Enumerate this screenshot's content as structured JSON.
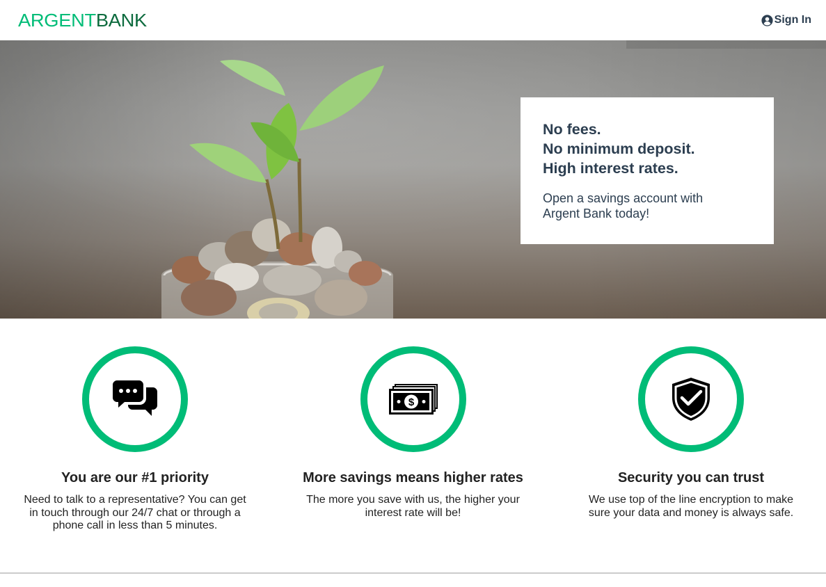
{
  "nav": {
    "logo_part1": "ARGENT",
    "logo_part2": "BANK",
    "signin_label": "Sign In",
    "signin_icon": "user-circle-icon"
  },
  "hero": {
    "image_subject": "plant growing from jar of coins",
    "promo_lines": [
      "No fees.",
      "No minimum deposit.",
      "High interest rates."
    ],
    "promo_text": "Open a savings account with Argent Bank today!"
  },
  "features": [
    {
      "icon": "chat-icon",
      "title": "You are our #1 priority",
      "text": "Need to talk to a representative? You can get in touch through our 24/7 chat or through a phone call in less than 5 minutes."
    },
    {
      "icon": "money-icon",
      "title": "More savings means higher rates",
      "text": "The more you save with us, the higher your interest rate will be!"
    },
    {
      "icon": "security-icon",
      "title": "Security you can trust",
      "text": "We use top of the line encryption to make sure your data and money is always safe."
    }
  ],
  "colors": {
    "accent": "#00bc77",
    "brand_dark": "#0d6b3e",
    "text": "#2c3e50",
    "footer_border": "#cccccc"
  }
}
